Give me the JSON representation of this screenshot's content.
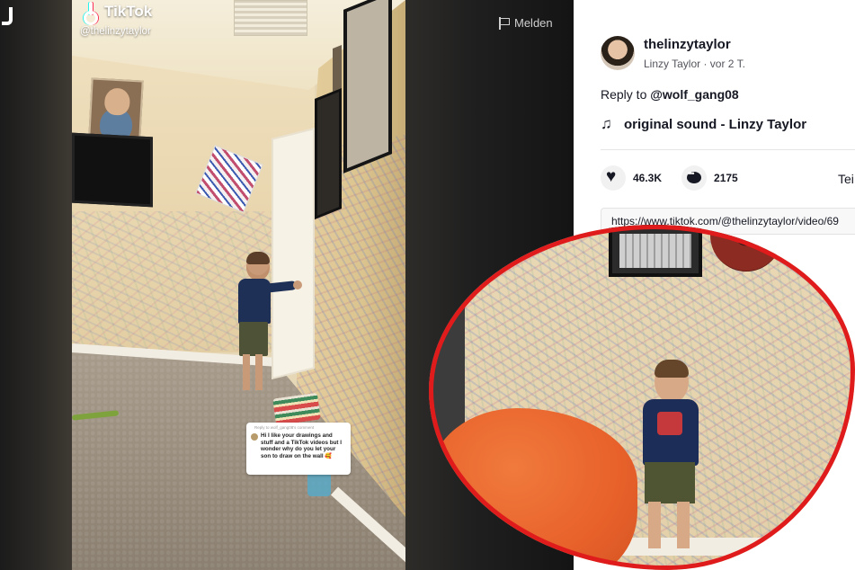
{
  "video": {
    "watermark": "TikTok",
    "handle": "@thelinzytaylor",
    "reply_sticker": {
      "header": "Reply to wolf_gang08's comment",
      "text": "Hi I like your drawings and stuff and a TikTok videos but I wonder why do you let your son to draw on the wall 🥰"
    }
  },
  "report": {
    "label": "Melden",
    "icon": "flag-icon"
  },
  "panel": {
    "username": "thelinzytaylor",
    "display_meta": "Linzy Taylor · vor 2 T.",
    "reply_prefix": "Reply to",
    "reply_user": "@wolf_gang08",
    "sound": "original sound - Linzy Taylor",
    "likes": "46.3K",
    "comments": "2175",
    "share_label": "Tei",
    "url": "https://www.tiktok.com/@thelinzytaylor/video/69"
  },
  "colors": {
    "highlight_ring": "#e01b1b",
    "text_primary": "#161823"
  }
}
